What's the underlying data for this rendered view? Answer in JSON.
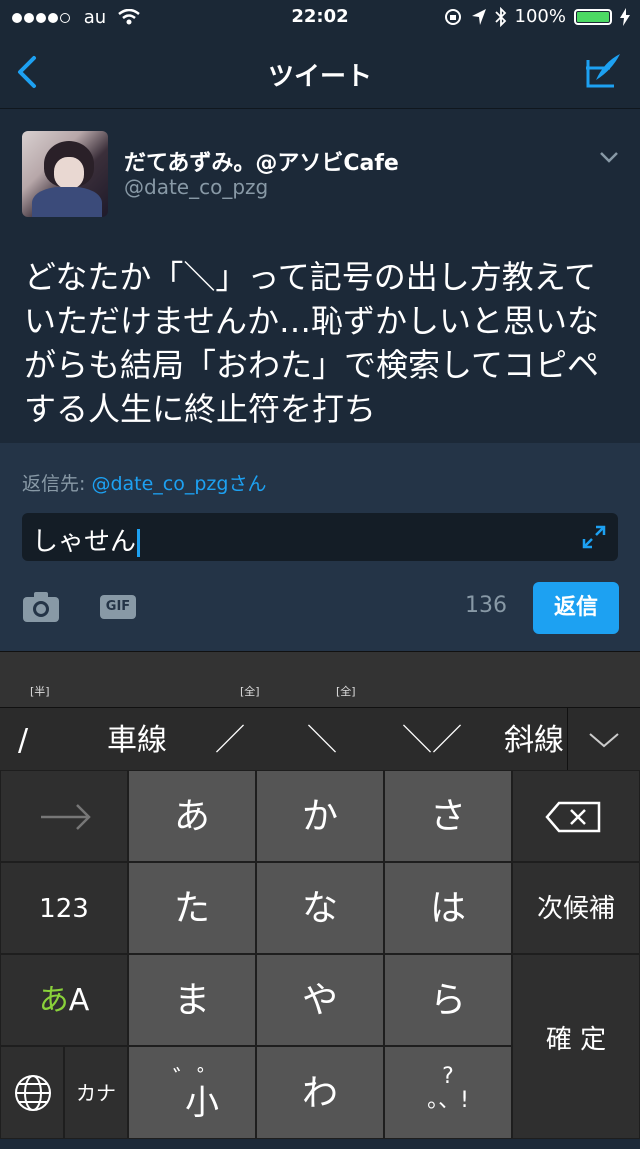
{
  "status_bar": {
    "carrier": "au",
    "time": "22:02",
    "battery_percent": "100%",
    "battery_level": 1.0
  },
  "nav": {
    "title": "ツイート"
  },
  "tweet": {
    "display_name": "だてあずみ。@アソビCafe",
    "handle": "@date_co_pzg",
    "text": "どなたか「＼」って記号の出し方教えていただけませんか…恥ずかしいと思いながらも結局「おわた」で検索してコピペする人生に終止符を打ち"
  },
  "reply": {
    "reply_to_label": "返信先: ",
    "reply_to_user": "@date_co_pzgさん",
    "input_text": "しゃせん",
    "gif_label": "GIF",
    "char_count": "136",
    "reply_button": "返信"
  },
  "keyboard": {
    "candidates": [
      {
        "label": "/",
        "tag": "[半]"
      },
      {
        "label": "車線",
        "tag": ""
      },
      {
        "label": "／",
        "tag": "[全]"
      },
      {
        "label": "＼",
        "tag": "[全]"
      },
      {
        "label": "＼／",
        "tag": ""
      },
      {
        "label": "斜線",
        "tag": ""
      }
    ],
    "keys": {
      "a": "あ",
      "ka": "か",
      "sa": "さ",
      "ta": "た",
      "na": "な",
      "ha": "は",
      "ma": "ま",
      "ya": "や",
      "ra": "ら",
      "dakuten": "゛゜",
      "small": "小",
      "wa": "わ",
      "punct": "?\n。、!",
      "num": "123",
      "mode_a": "あ",
      "mode_A": "A",
      "kana": "カナ",
      "next": "次候補",
      "confirm": "確 定"
    },
    "mode_color": "#8ad23a"
  }
}
